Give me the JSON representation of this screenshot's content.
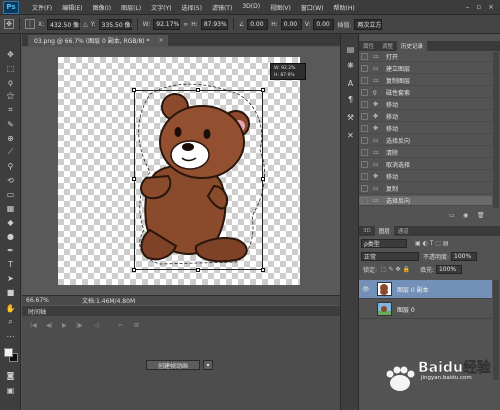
{
  "app": {
    "logo": "Ps",
    "menu": [
      "文件(F)",
      "编辑(E)",
      "图像(I)",
      "图层(L)",
      "文字(Y)",
      "选择(S)",
      "滤镜(T)",
      "3D(D)",
      "视图(V)",
      "窗口(W)",
      "帮助(H)"
    ]
  },
  "options_bar": {
    "x_label": "X:",
    "x_value": "432.50 像:",
    "y_label": "Y:",
    "y_value": "335.50 像:",
    "w_label": "W:",
    "w_value": "92.17%",
    "h_label": "H:",
    "h_value": "87.93%",
    "angle_value": "0.00",
    "hskew_label": "H:",
    "hskew_value": "0.00",
    "vskew_label": "V:",
    "vskew_value": "0.00",
    "interp_label": "插值:",
    "interp_value": "两次立方"
  },
  "document": {
    "tab_title": "03.png @ 66.7% (图层 0 副本, RGB/8) *",
    "tab_close": "×",
    "transform_tip_w": "W: 92.2%",
    "transform_tip_h": "H: 87.9%"
  },
  "status": {
    "zoom": "66.67%",
    "doc_info": "文档:1.46M/4.80M"
  },
  "timeline": {
    "tab_label": "时间轴",
    "create_button": "创建帧动画",
    "dropdown": "▾"
  },
  "history_panel": {
    "tabs": [
      "属性",
      "调整",
      "历史记录"
    ],
    "active_tab": 2,
    "items": [
      {
        "label": "打开",
        "selected": false
      },
      {
        "label": "建立图层",
        "selected": false
      },
      {
        "label": "复制图层",
        "selected": false
      },
      {
        "label": "磁性套索",
        "selected": false
      },
      {
        "label": "移动",
        "selected": false
      },
      {
        "label": "移动",
        "selected": false
      },
      {
        "label": "移动",
        "selected": false
      },
      {
        "label": "选择反向",
        "selected": false
      },
      {
        "label": "清除",
        "selected": false
      },
      {
        "label": "取消选择",
        "selected": false
      },
      {
        "label": "移动",
        "selected": false
      },
      {
        "label": "复制",
        "selected": false
      },
      {
        "label": "选择反向",
        "selected": true
      }
    ]
  },
  "layers_panel": {
    "tabs": [
      "3D",
      "图层",
      "通道"
    ],
    "active_tab": 1,
    "kind_filter": "ρ类型",
    "blend_mode": "正常",
    "opacity_label": "不透明度:",
    "opacity_value": "100%",
    "lock_label": "锁定:",
    "fill_label": "填充:",
    "fill_value": "100%",
    "layers": [
      {
        "name": "图层 0 副本",
        "selected": true,
        "visible": true
      },
      {
        "name": "图层 0",
        "selected": false,
        "visible": false
      }
    ]
  },
  "watermark": {
    "brand": "Baidu经验",
    "url": "jingyan.baidu.com"
  }
}
